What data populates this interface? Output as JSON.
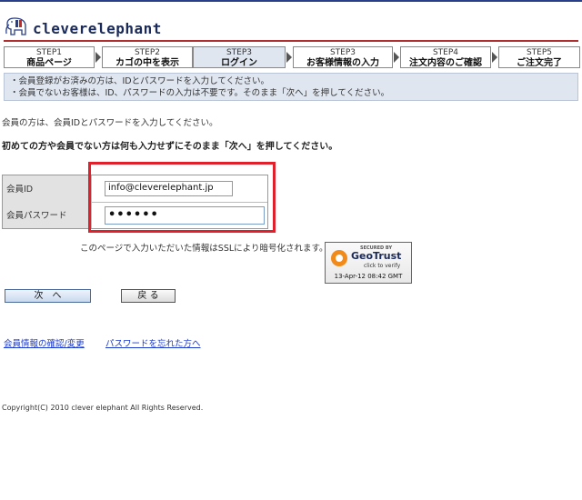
{
  "brand": {
    "name": "cleverelephant"
  },
  "steps": [
    {
      "num": "STEP1",
      "label": "商品ページ"
    },
    {
      "num": "STEP2",
      "label": "カゴの中を表示"
    },
    {
      "num": "STEP3",
      "label": "ログイン"
    },
    {
      "num": "STEP3",
      "label": "お客様情報の入力"
    },
    {
      "num": "STEP4",
      "label": "注文内容のご確認"
    },
    {
      "num": "STEP5",
      "label": "ご注文完了"
    }
  ],
  "notice": {
    "line1": "・会員登録がお済みの方は、IDとパスワードを入力してください。",
    "line2": "・会員でないお客様は、ID、パスワードの入力は不要です。そのまま「次へ」を押してください。"
  },
  "instructions": {
    "member": "会員の方は、会員IDとパスワードを入力してください。",
    "guest": "初めての方や会員でない方は何も入力せずにそのまま「次へ」を押してください。"
  },
  "form": {
    "id_label": "会員ID",
    "id_value": "info@cleverelephant.jp",
    "password_label": "会員パスワード",
    "password_value": "••••••"
  },
  "ssl": {
    "text": "このページで入力いただいた情報はSSLにより暗号化されます。",
    "badge": {
      "secured": "SECURED BY",
      "name": "GeoTrust",
      "verify": "click to verify",
      "date": "13-Apr-12 08:42 GMT"
    }
  },
  "buttons": {
    "next": "次　へ",
    "back": "戻 る"
  },
  "links": {
    "member_info": "会員情報の確認/変更",
    "forgot_password": "パスワードを忘れた方へ"
  },
  "footer": {
    "copyright": "Copyright(C) 2010 clever elephant All Rights Reserved."
  },
  "colors": {
    "accent_red": "#e0202a",
    "brand_navy": "#1a2a5a",
    "link": "#1a3acc",
    "panel": "#dfe6f0"
  }
}
